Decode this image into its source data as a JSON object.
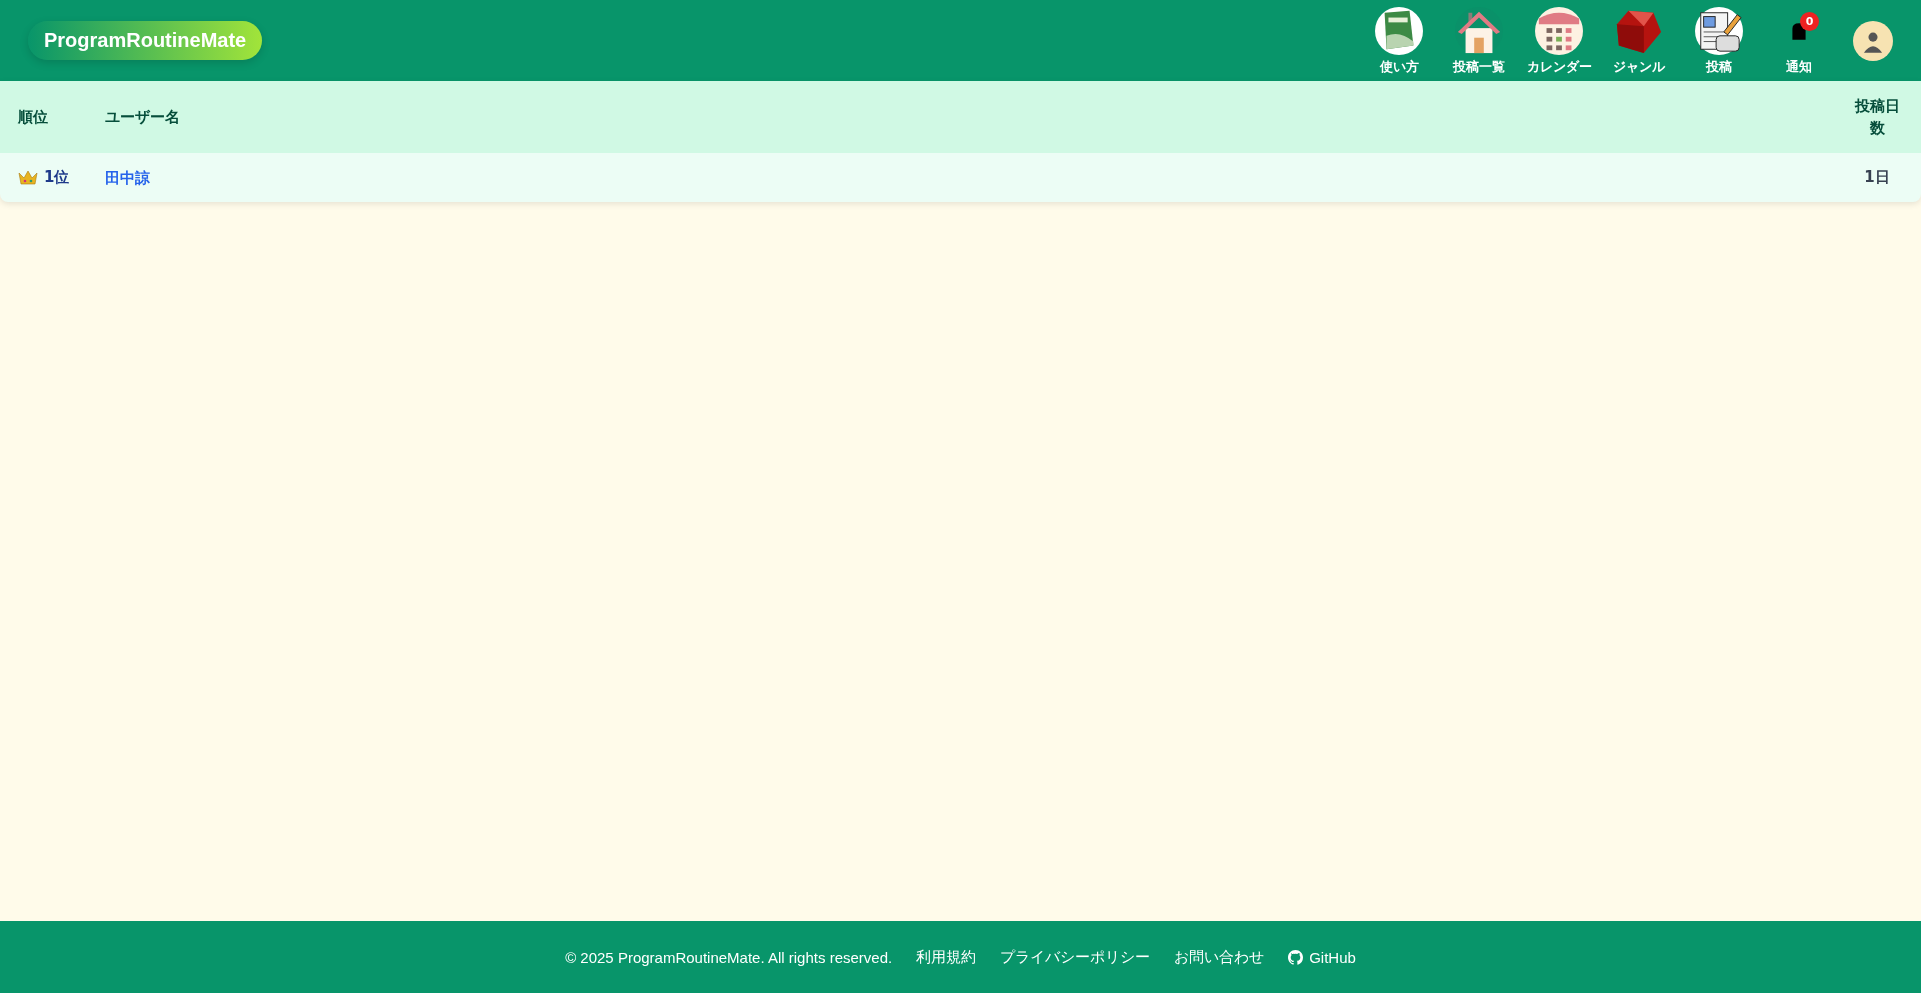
{
  "brand": "ProgramRoutineMate",
  "nav": [
    {
      "kind": "book",
      "label": "使い方"
    },
    {
      "kind": "house",
      "label": "投稿一覧"
    },
    {
      "kind": "calendar",
      "label": "カレンダー"
    },
    {
      "kind": "gem",
      "label": "ジャンル"
    },
    {
      "kind": "post",
      "label": "投稿"
    },
    {
      "kind": "bell",
      "label": "通知",
      "badge": "0"
    },
    {
      "kind": "avatar"
    }
  ],
  "table": {
    "columns": [
      "順位",
      "ユーザー名",
      "投稿日数"
    ],
    "rows": [
      {
        "crown": true,
        "rank": "1位",
        "user": "田中諒",
        "days": "1日"
      }
    ]
  },
  "footer": {
    "copyright": "© 2025 ProgramRoutineMate. All rights reserved.",
    "links": [
      {
        "kind": "text",
        "label": "利用規約"
      },
      {
        "kind": "text",
        "label": "プライバシーポリシー"
      },
      {
        "kind": "text",
        "label": "お問い合わせ"
      },
      {
        "kind": "github",
        "label": "GitHub"
      }
    ]
  }
}
